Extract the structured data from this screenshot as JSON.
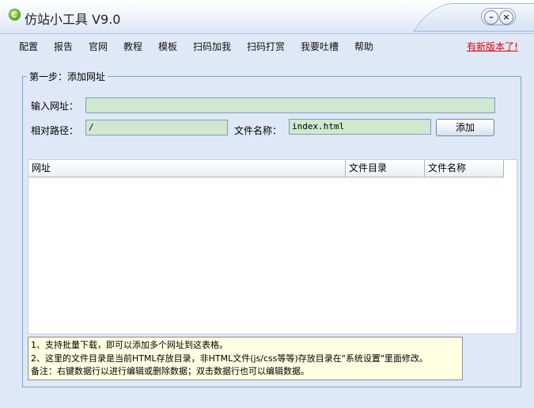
{
  "window": {
    "title": "仿站小工具 V9.0",
    "minimize_label": "–",
    "close_label": "×"
  },
  "menu": {
    "items": [
      "配置",
      "报告",
      "官网",
      "教程",
      "模板",
      "扫码加我",
      "扫码打赏",
      "我要吐槽",
      "帮助"
    ],
    "update_link": "有新版本了!"
  },
  "step": {
    "title": "第一步：添加网址",
    "url_label": "输入网址：",
    "url_value": "",
    "path_label": "相对路径：",
    "path_value": "/",
    "filename_label": "文件名称：",
    "filename_value": "index.html",
    "add_button": "添加"
  },
  "table": {
    "columns": [
      "网址",
      "文件目录",
      "文件名称"
    ],
    "rows": []
  },
  "info": {
    "lines": [
      "1、支持批量下载，即可以添加多个网址到这表格。",
      "2、这里的文件目录是当前HTML存放目录，非HTML文件(js/css等等)存放目录在\"系统设置\"里面修改。",
      "备注：右键数据行以进行编辑或删除数据；双击数据行也可以编辑数据。"
    ]
  },
  "colors": {
    "background": "#dfe8f6",
    "input_bg": "#cfe8cf",
    "link": "#e00000",
    "info_bg": "#ffffe1"
  },
  "icons": {
    "app": "app-logo-icon"
  }
}
